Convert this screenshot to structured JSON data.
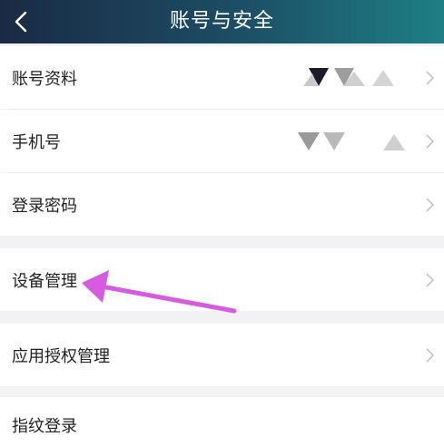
{
  "header": {
    "title": "账号与安全"
  },
  "sections": [
    {
      "items": [
        {
          "label": "账号资料"
        },
        {
          "label": "手机号"
        },
        {
          "label": "登录密码"
        }
      ]
    },
    {
      "items": [
        {
          "label": "设备管理"
        }
      ]
    },
    {
      "items": [
        {
          "label": "应用授权管理"
        }
      ]
    },
    {
      "items": [
        {
          "label": "指纹登录"
        }
      ]
    }
  ],
  "colors": {
    "header_start": "#1b2a44",
    "header_end": "#1e7f84",
    "annotation_arrow": "#d65be0"
  }
}
